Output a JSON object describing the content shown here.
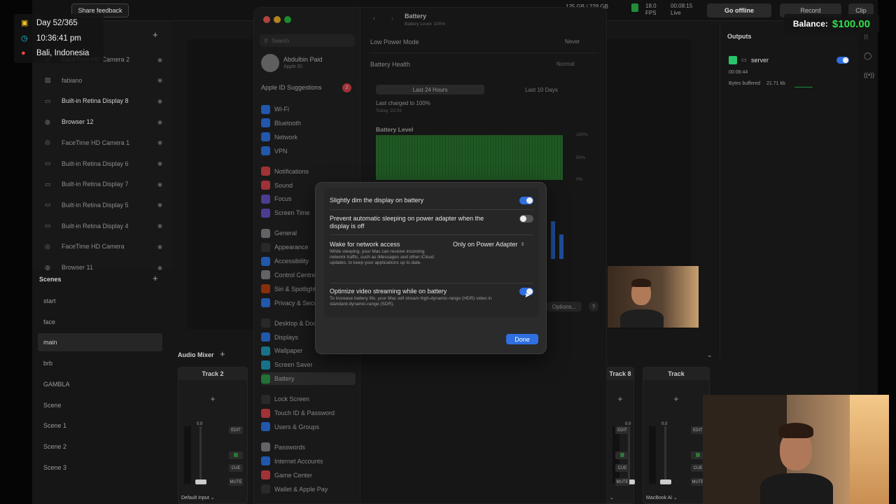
{
  "overlay": {
    "day": "Day 52/365",
    "time": "10:36:41 pm",
    "location": "Bali, Indonesia",
    "balance_label": "Balance:",
    "balance_value": "$100.00"
  },
  "app": {
    "share_feedback": "Share feedback",
    "go_offline": "Go offline",
    "record": "Record",
    "clip": "Clip",
    "stats": {
      "storage": "125 GB / 228 GB",
      "fps_value": "18.0",
      "fps_label": "FPS",
      "live_time": "00:08:15",
      "live_label": "Live"
    },
    "sources": [
      {
        "label": "FaceTime HD Camera 2",
        "icon": "camera-icon"
      },
      {
        "label": "fabiano",
        "icon": "image-icon"
      },
      {
        "label": "Built-in Retina Display 8",
        "icon": "display-icon"
      },
      {
        "label": "Browser 12",
        "icon": "globe-icon"
      },
      {
        "label": "FaceTime HD Camera 1",
        "icon": "camera-icon"
      },
      {
        "label": "Built-in Retina Display 6",
        "icon": "display-icon"
      },
      {
        "label": "Built-in Retina Display 7",
        "icon": "display-icon"
      },
      {
        "label": "Built-in Retina Display 5",
        "icon": "display-icon"
      },
      {
        "label": "Built-in Retina Display 4",
        "icon": "display-icon"
      },
      {
        "label": "FaceTime HD Camera",
        "icon": "camera-icon"
      },
      {
        "label": "Browser 11",
        "icon": "globe-icon"
      }
    ],
    "scenes_title": "Scenes",
    "scenes": [
      "start",
      "face",
      "main",
      "brb",
      "GAMBLA",
      "Scene",
      "Scene 1",
      "Scene 2",
      "Scene 3"
    ],
    "active_scene": "main",
    "audio_mixer_title": "Audio Mixer",
    "tracks": [
      {
        "name": "Track 2",
        "device": "Default Input"
      },
      {
        "name": "Track 8",
        "device": ""
      },
      {
        "name": "Track",
        "device": "MacBook Ai"
      }
    ],
    "track_buttons": {
      "edit": "EDIT",
      "cue": "CUE",
      "mute": "MUTE",
      "level": "0.0"
    },
    "outputs_title": "Outputs",
    "output": {
      "name": "server",
      "time": "00:06:44",
      "buffer_label": "Bytes buffered",
      "buffer_value": "21.71 kb"
    }
  },
  "settings": {
    "search_placeholder": "Search",
    "user_name": "Abdulbin Paid",
    "user_sub": "Apple ID",
    "suggestions": "Apple ID Suggestions",
    "suggestions_badge": "2",
    "nav": [
      {
        "label": "Wi-Fi",
        "color": "#2f7cf6"
      },
      {
        "label": "Bluetooth",
        "color": "#2f7cf6"
      },
      {
        "label": "Network",
        "color": "#2f7cf6"
      },
      {
        "label": "VPN",
        "color": "#2f7cf6"
      },
      {
        "label": "Notifications",
        "color": "#e5484d"
      },
      {
        "label": "Sound",
        "color": "#e5484d"
      },
      {
        "label": "Focus",
        "color": "#6e56cf"
      },
      {
        "label": "Screen Time",
        "color": "#6e56cf"
      },
      {
        "label": "General",
        "color": "#8e8e93"
      },
      {
        "label": "Appearance",
        "color": "#3a3a3a"
      },
      {
        "label": "Accessibility",
        "color": "#2f7cf6"
      },
      {
        "label": "Control Centre",
        "color": "#8e8e93"
      },
      {
        "label": "Siri & Spotlight",
        "color": "#c2410c"
      },
      {
        "label": "Privacy & Security",
        "color": "#2f7cf6"
      },
      {
        "label": "Desktop & Dock",
        "color": "#3a3a3a"
      },
      {
        "label": "Displays",
        "color": "#2f7cf6"
      },
      {
        "label": "Wallpaper",
        "color": "#22a3c4"
      },
      {
        "label": "Screen Saver",
        "color": "#22a3c4"
      },
      {
        "label": "Battery",
        "color": "#30a14e"
      },
      {
        "label": "Lock Screen",
        "color": "#3a3a3a"
      },
      {
        "label": "Touch ID & Password",
        "color": "#e5484d"
      },
      {
        "label": "Users & Groups",
        "color": "#2f7cf6"
      },
      {
        "label": "Passwords",
        "color": "#8e8e93"
      },
      {
        "label": "Internet Accounts",
        "color": "#2f7cf6"
      },
      {
        "label": "Game Center",
        "color": "#e5484d"
      },
      {
        "label": "Wallet & Apple Pay",
        "color": "#3a3a3a"
      }
    ],
    "selected_nav": "Battery",
    "battery": {
      "title": "Battery",
      "level_text": "Battery Level: 100%",
      "low_power_label": "Low Power Mode",
      "low_power_value": "Never",
      "health_label": "Battery Health",
      "health_value": "Normal",
      "seg_24h": "Last 24 Hours",
      "seg_10d": "Last 10 Days",
      "last_charged": "Last charged to 100%",
      "last_charged_time": "Today, 22:03",
      "chart_title": "Battery Level",
      "pct_labels": [
        "100%",
        "50%",
        "0%"
      ],
      "options_button": "Options...",
      "help": "?"
    }
  },
  "modal": {
    "rows": [
      {
        "title": "Slightly dim the display on battery",
        "toggle": true
      },
      {
        "title": "Prevent automatic sleeping on power adapter when the display is off",
        "toggle": false
      },
      {
        "title": "Wake for network access",
        "desc": "While sleeping, your Mac can receive incoming network traffic, such as iMessages and other iCloud updates, to keep your applications up to date.",
        "select": "Only on Power Adapter"
      },
      {
        "title": "Optimize video streaming while on battery",
        "desc": "To increase battery life, your Mac will stream high-dynamic-range (HDR) video in standard-dynamic-range (SDR).",
        "toggle": true
      }
    ],
    "done": "Done"
  },
  "colors": {
    "accent_blue": "#2f6fe0",
    "balance_green": "#2ee04a",
    "battery_green": "#2e7d32"
  }
}
